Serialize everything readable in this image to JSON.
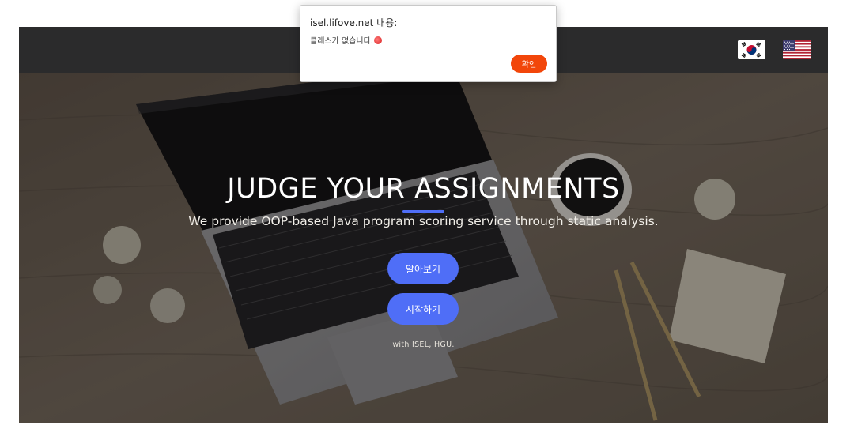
{
  "alert": {
    "title": "isel.lifove.net 내용:",
    "message": "클래스가 없습니다.",
    "emoji_icon": "pouting-face-icon",
    "ok_label": "확인",
    "ok_color": "#f2460a"
  },
  "navbar": {
    "background": "#2b2b2c",
    "languages": [
      {
        "name": "korean-flag-icon"
      },
      {
        "name": "us-flag-icon"
      }
    ]
  },
  "hero": {
    "headline": "JUDGE YOUR ASSIGNMENTS",
    "subhead": "We provide OOP-based Java program scoring service through static analysis.",
    "learn_more_label": "알아보기",
    "start_label": "시작하기",
    "credit": "with ISEL, HGU.",
    "accent_color": "#4f6ef7"
  }
}
